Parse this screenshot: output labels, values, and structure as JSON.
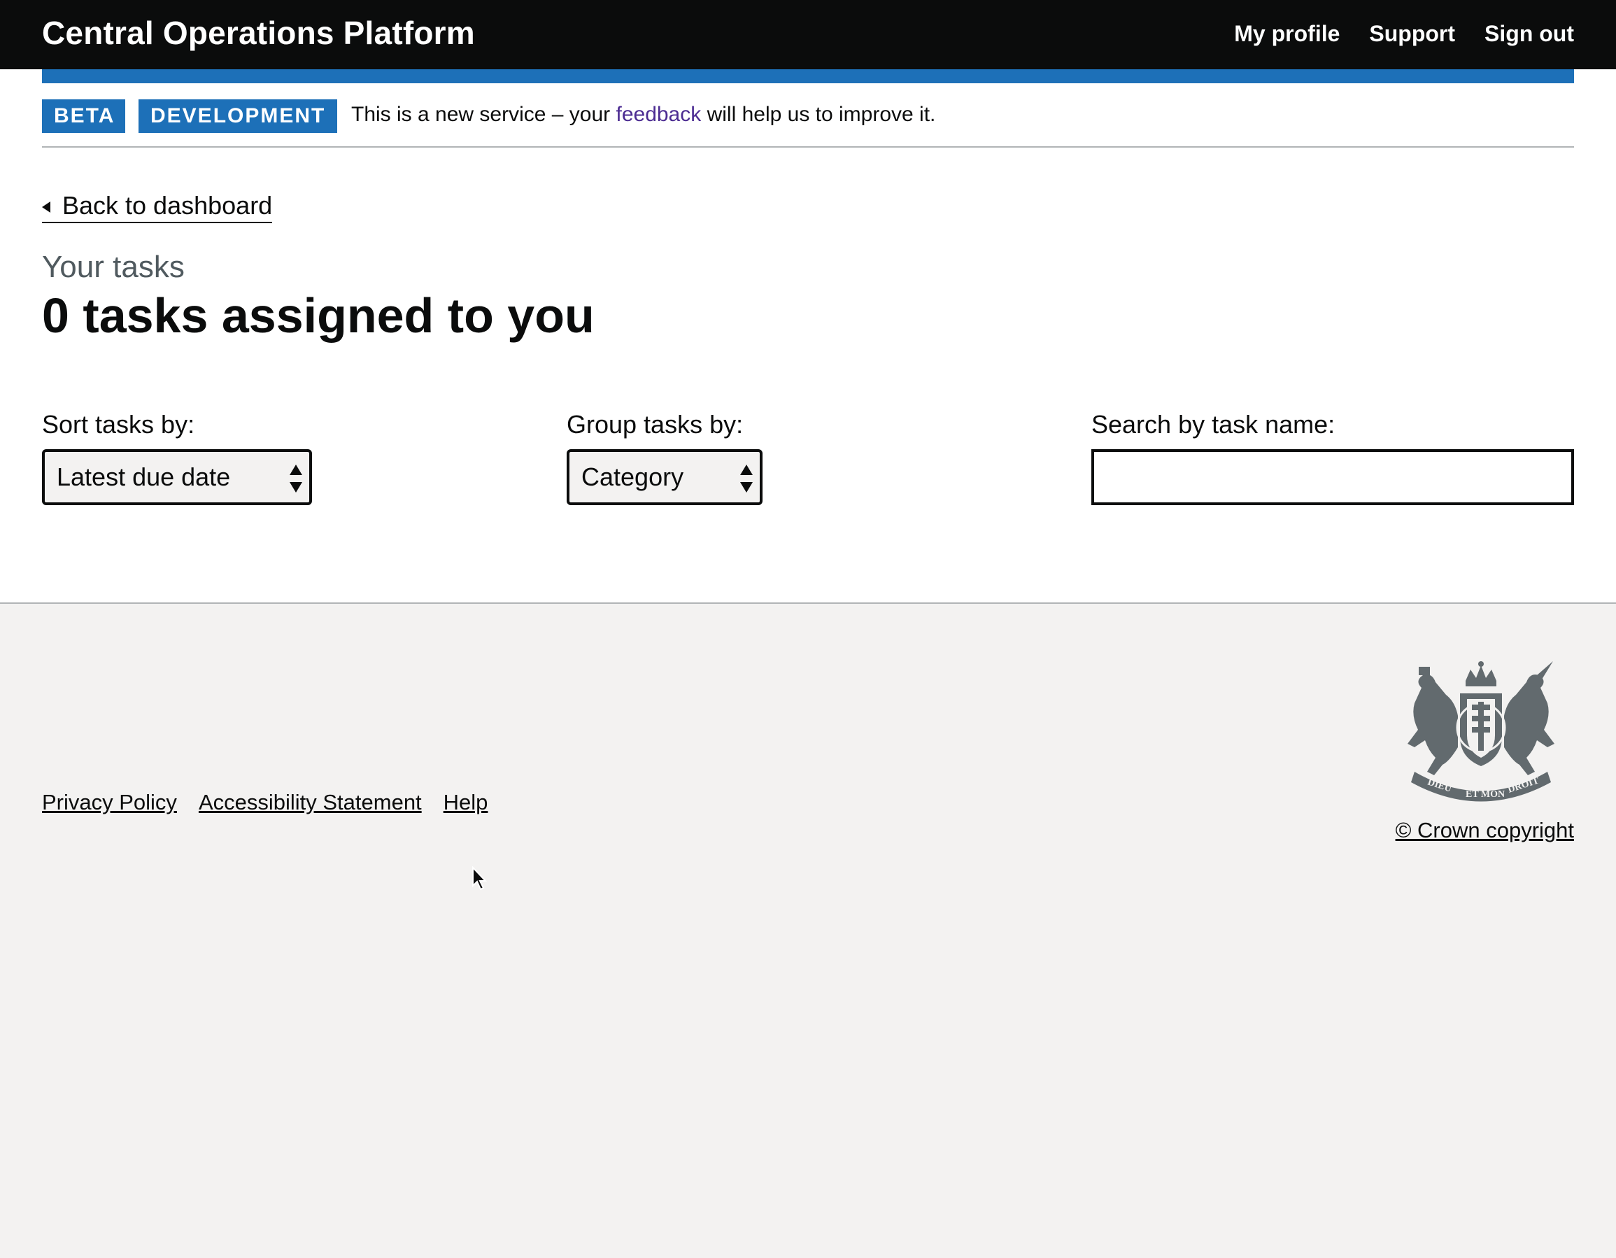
{
  "header": {
    "title": "Central Operations Platform",
    "nav": [
      "My profile",
      "Support",
      "Sign out"
    ]
  },
  "phase_banner": {
    "tags": [
      "BETA",
      "DEVELOPMENT"
    ],
    "text_before": "This is a new service – your ",
    "link_text": "feedback",
    "text_after": " will help us to improve it."
  },
  "back_link": "Back to dashboard",
  "caption": "Your tasks",
  "heading": "0 tasks assigned to you",
  "form": {
    "sort_label": "Sort tasks by:",
    "sort_value": "Latest due date",
    "group_label": "Group tasks by:",
    "group_value": "Category",
    "search_label": "Search by task name:",
    "search_value": ""
  },
  "footer": {
    "links": [
      "Privacy Policy",
      "Accessibility Statement",
      "Help"
    ],
    "copyright": "© Crown copyright",
    "crest_text": [
      "DIEU",
      "ET MON",
      "DROIT"
    ]
  },
  "colors": {
    "header_bg": "#0b0c0c",
    "accent_blue": "#1d70b8",
    "link_visited": "#4c2c92",
    "footer_bg": "#f3f2f1",
    "secondary_text": "#505a5f"
  }
}
